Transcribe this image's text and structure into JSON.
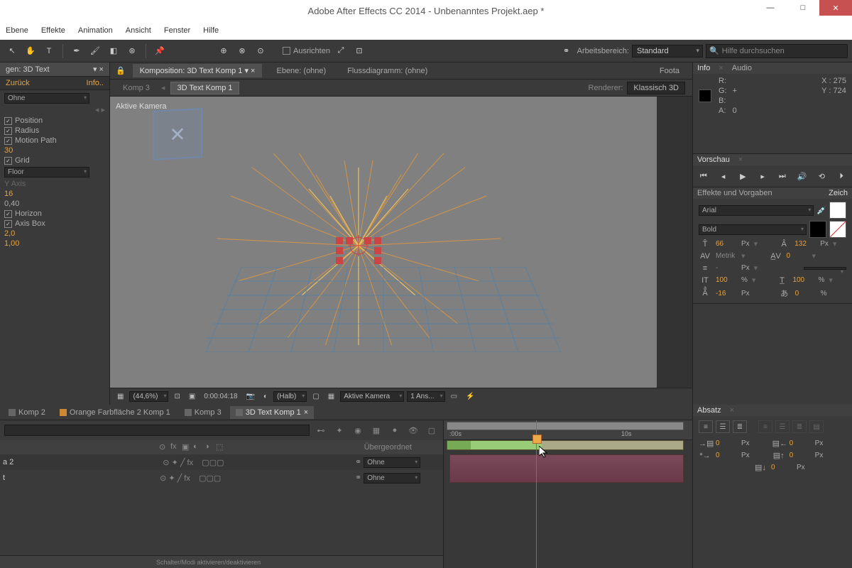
{
  "title": "Adobe After Effects CC 2014 - Unbenanntes Projekt.aep *",
  "menu": [
    "Ebene",
    "Effekte",
    "Animation",
    "Ansicht",
    "Fenster",
    "Hilfe"
  ],
  "toolbar": {
    "align_label": "Ausrichten",
    "workspace_label": "Arbeitsbereich:",
    "workspace_value": "Standard",
    "search_placeholder": "Hilfe durchsuchen"
  },
  "left": {
    "tab_label": "gen: 3D Text",
    "back": "Zurück",
    "info": "Info..",
    "shape": "Ohne",
    "props": {
      "position": "Position",
      "radius": "Radius",
      "motion_path": "Motion Path",
      "v30": "30",
      "grid": "Grid",
      "floor": "Floor",
      "yaxis": "Y Axis",
      "v16": "16",
      "v040": "0,40",
      "horizon": "Horizon",
      "axisbox": "Axis Box",
      "v20": "2,0",
      "v100": "1,00"
    }
  },
  "comp": {
    "tab_prefix": "Komposition:",
    "tab_active": "3D Text Komp 1",
    "tab_layer": "Ebene: (ohne)",
    "tab_flow": "Flussdiagramm: (ohne)",
    "tab_foota": "Foota",
    "bc1": "Komp 3",
    "bc2": "3D Text Komp 1",
    "renderer_label": "Renderer:",
    "renderer_value": "Klassisch 3D",
    "viewport_label": "Aktive Kamera"
  },
  "footer": {
    "zoom": "(44,6%)",
    "timecode": "0:00:04:18",
    "res": "(Halb)",
    "view": "Aktive Kamera",
    "ansicht": "1 Ans..."
  },
  "info": {
    "tab1": "Info",
    "tab2": "Audio",
    "R": "R:",
    "G": "G:",
    "B": "B:",
    "A": "A:",
    "Aval": "0",
    "X": "X :",
    "Xval": "275",
    "Y": "Y :",
    "Yval": "724"
  },
  "preview": {
    "tab": "Vorschau"
  },
  "effects_tab": "Effekte und Vorgaben",
  "char_tab": "Zeich",
  "char": {
    "font": "Arial",
    "style": "Bold",
    "size": "66",
    "size_unit": "Px",
    "leading": "132",
    "leading_unit": "Px",
    "kerning": "Metrik",
    "tracking": "0",
    "stroke": "-",
    "stroke_unit": "Px",
    "vscale": "100",
    "hscale": "100",
    "pct": "%",
    "baseline": "-16",
    "baseline_unit": "Px",
    "tsume": "0",
    "tsume_unit": "%"
  },
  "absatz": {
    "tab": "Absatz",
    "zero": "0",
    "unit": "Px"
  },
  "timeline": {
    "tabs": [
      "Komp 2",
      "Orange Farbfläche 2 Komp 1",
      "Komp 3",
      "3D Text Komp 1"
    ],
    "parent_label": "Übergeordnet",
    "parent_value": "Ohne",
    "layer1": "a 2",
    "layer2": "t",
    "t0": ":00s",
    "t10": "10s",
    "footer": "Schalter/Modi aktivieren/deaktivieren"
  }
}
